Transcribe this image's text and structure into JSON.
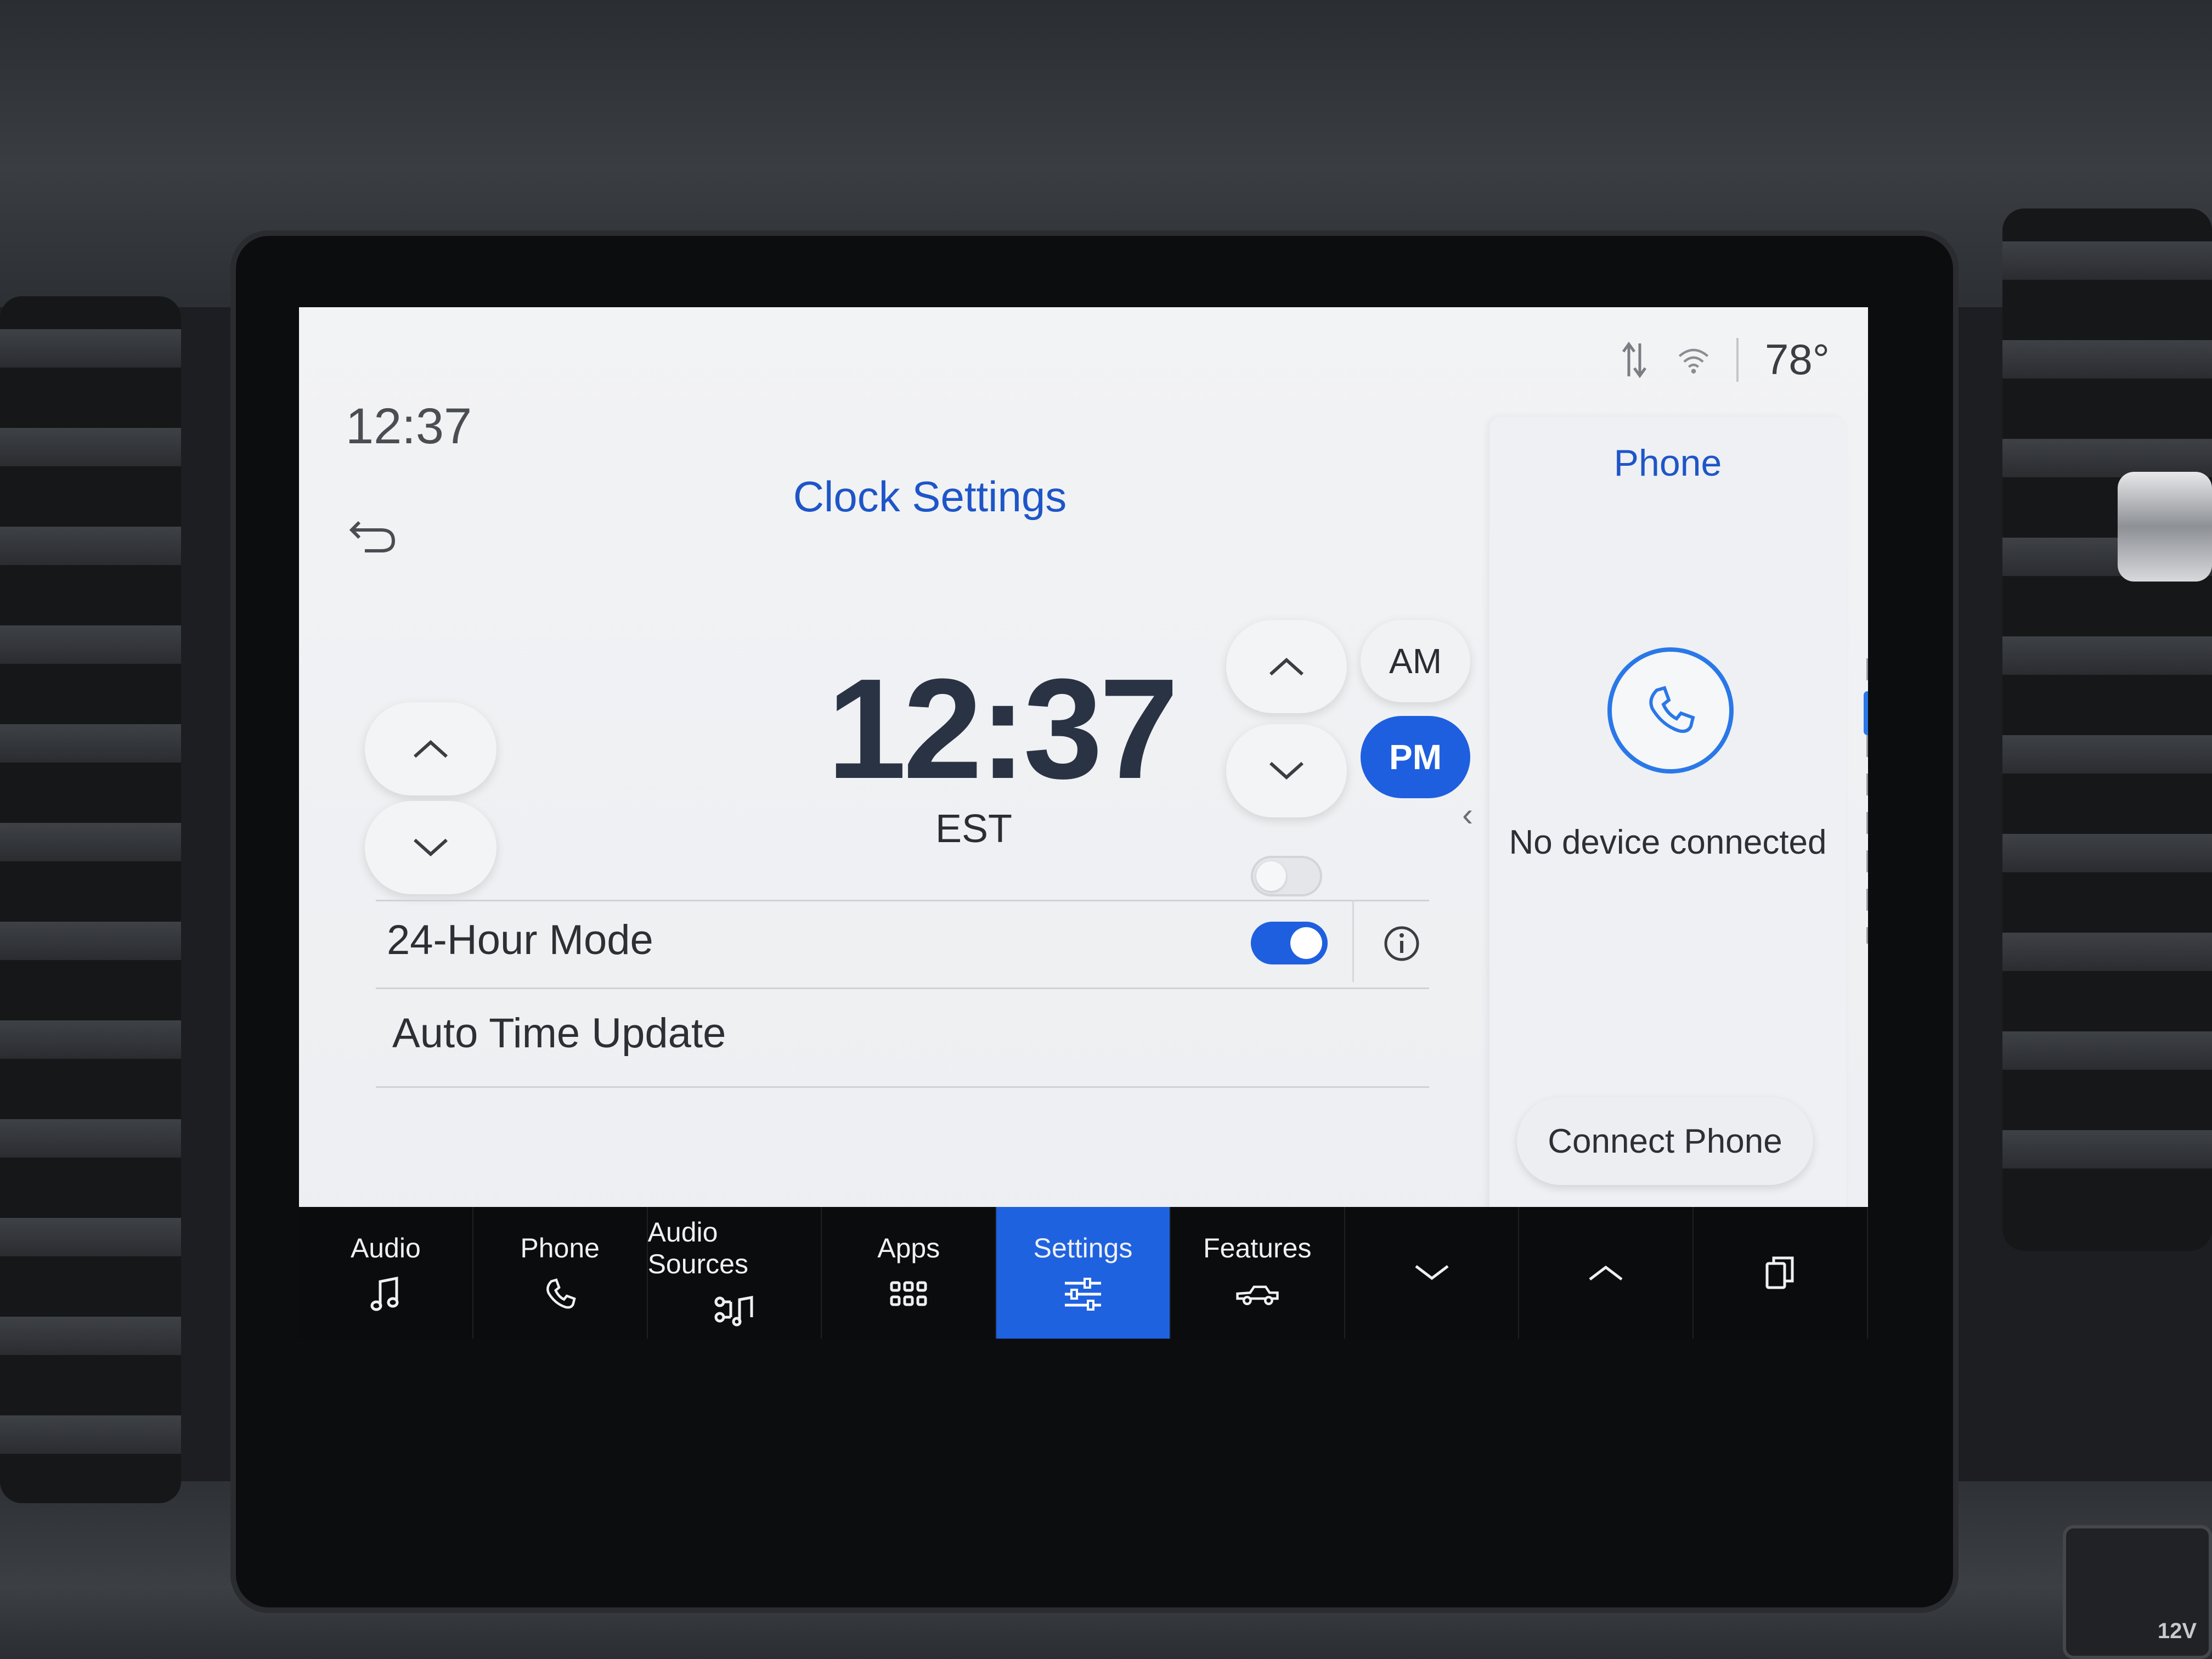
{
  "status": {
    "time": "12:37",
    "temperature": "78°",
    "icons": [
      "data-transfer-icon",
      "wifi-icon"
    ]
  },
  "page": {
    "title": "Clock Settings",
    "back_icon": "back-arrow-icon"
  },
  "clock": {
    "time": "12:37",
    "timezone": "EST",
    "meridiem_options": [
      "AM",
      "PM"
    ],
    "selected_meridiem": "PM"
  },
  "settings": {
    "rows": [
      {
        "label": "24-Hour Mode",
        "enabled": false
      },
      {
        "label": "Auto Time Update",
        "enabled": true
      }
    ]
  },
  "phone_panel": {
    "title": "Phone",
    "status_text": "No device connected",
    "connect_label": "Connect Phone"
  },
  "nav": {
    "items": [
      {
        "label": "Audio",
        "icon": "music-note-icon",
        "active": false
      },
      {
        "label": "Phone",
        "icon": "phone-icon",
        "active": false
      },
      {
        "label": "Audio Sources",
        "icon": "audio-sources-icon",
        "active": false
      },
      {
        "label": "Apps",
        "icon": "apps-grid-icon",
        "active": false
      },
      {
        "label": "Settings",
        "icon": "sliders-icon",
        "active": true
      },
      {
        "label": "Features",
        "icon": "truck-icon",
        "active": false
      },
      {
        "label": "",
        "icon": "chevron-down-icon",
        "active": false
      },
      {
        "label": "",
        "icon": "chevron-up-icon",
        "active": false
      },
      {
        "label": "",
        "icon": "windows-icon",
        "active": false
      }
    ]
  },
  "colors": {
    "accent": "#1e5fe0",
    "title_blue": "#1e55c8",
    "screen_bg": "#f2f3f5",
    "nav_bg": "#0b0c0e"
  }
}
